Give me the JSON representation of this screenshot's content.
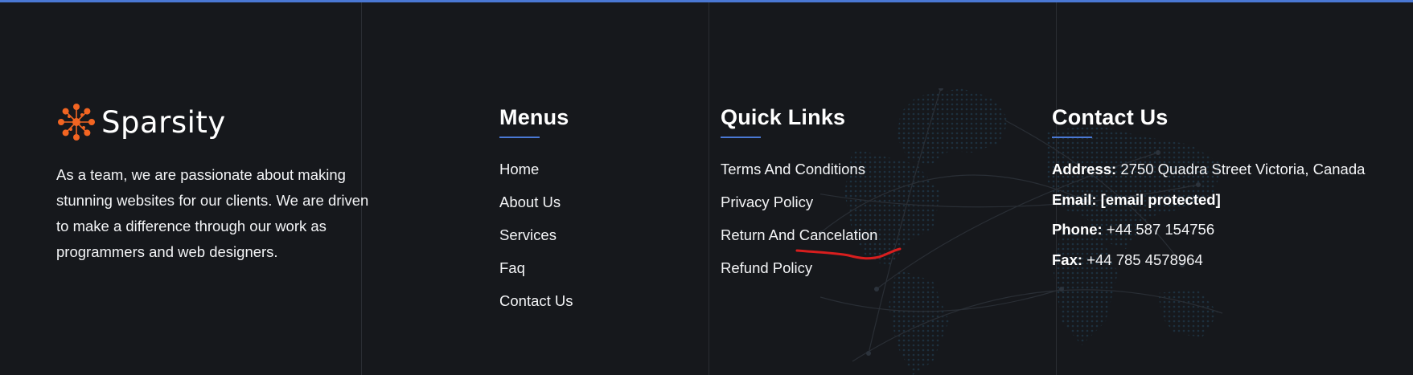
{
  "brand": {
    "name": "Sparsity",
    "description": "As a team, we are passionate about making stunning websites for our clients. We are driven to make a difference through our work as programmers and web designers."
  },
  "menus": {
    "heading": "Menus",
    "items": [
      "Home",
      "About Us",
      "Services",
      "Faq",
      "Contact Us"
    ]
  },
  "quick_links": {
    "heading": "Quick Links",
    "items": [
      "Terms And Conditions",
      "Privacy Policy",
      "Return And Cancelation",
      "Refund Policy"
    ]
  },
  "contact": {
    "heading": "Contact Us",
    "address_label": "Address:",
    "address": "2750 Quadra Street Victoria, Canada",
    "email_label": "Email:",
    "email": "[email protected]",
    "phone_label": "Phone:",
    "phone": "+44 587 154756",
    "fax_label": "Fax:",
    "fax": "+44 785 4578964"
  },
  "colors": {
    "background": "#16181c",
    "accent": "#4a78d4",
    "logo_orange": "#f26522",
    "annotation_red": "#d81e1e"
  },
  "icons": {
    "logo": "sparsity-starburst-icon",
    "background": "world-map-icon"
  }
}
